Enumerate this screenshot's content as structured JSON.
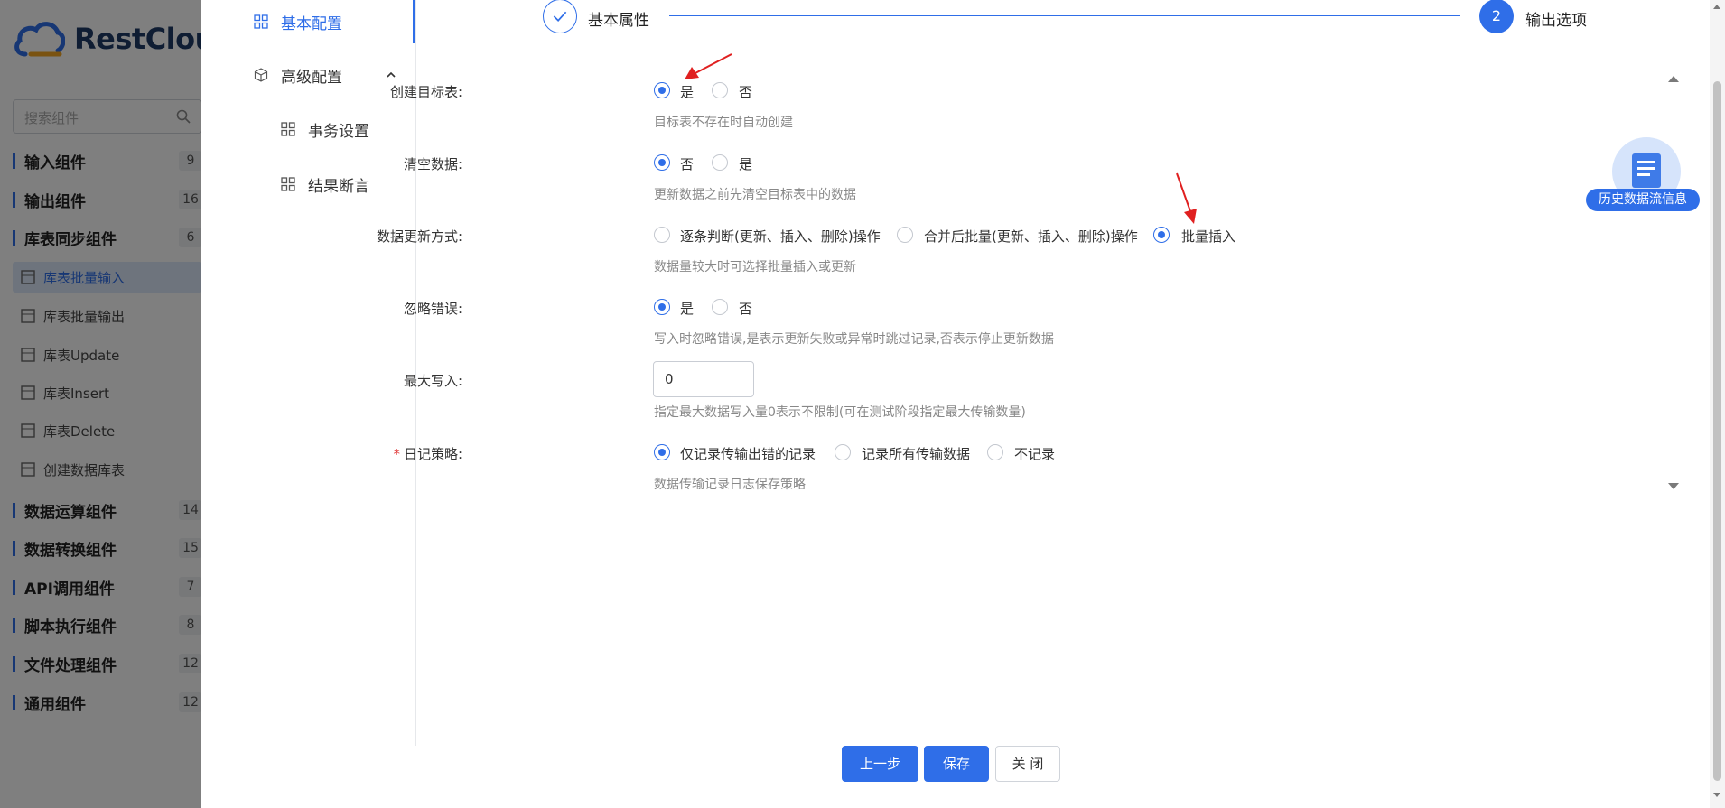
{
  "background": {
    "brand": "RestCloud",
    "search_placeholder": "搜索组件",
    "groups": [
      {
        "label": "输入组件",
        "count": "9"
      },
      {
        "label": "输出组件",
        "count": "16"
      },
      {
        "label": "库表同步组件",
        "count": "6"
      },
      {
        "label": "数据运算组件",
        "count": "14"
      },
      {
        "label": "数据转换组件",
        "count": "15"
      },
      {
        "label": "API调用组件",
        "count": "7"
      },
      {
        "label": "脚本执行组件",
        "count": "8"
      },
      {
        "label": "文件处理组件",
        "count": "12"
      },
      {
        "label": "通用组件",
        "count": "12"
      }
    ],
    "sync_items": [
      "库表批量输入",
      "库表批量输出",
      "库表Update",
      "库表Insert",
      "库表Delete",
      "创建数据库表"
    ]
  },
  "nav": {
    "basic": "基本配置",
    "advanced": "高级配置",
    "transaction": "事务设置",
    "assertion": "结果断言"
  },
  "steps": {
    "step1_label": "基本属性",
    "step2_number": "2",
    "step2_label": "输出选项"
  },
  "form": {
    "create_table": {
      "label": "创建目标表:",
      "opt_yes": "是",
      "opt_no": "否",
      "selected": "是",
      "hint": "目标表不存在时自动创建"
    },
    "clear_data": {
      "label": "清空数据:",
      "opt_no": "否",
      "opt_yes": "是",
      "selected": "否",
      "hint": "更新数据之前先清空目标表中的数据"
    },
    "update_mode": {
      "label": "数据更新方式:",
      "opt1": "逐条判断(更新、插入、删除)操作",
      "opt2": "合并后批量(更新、插入、删除)操作",
      "opt3": "批量插入",
      "selected": "批量插入",
      "hint": "数据量较大时可选择批量插入或更新"
    },
    "ignore_error": {
      "label": "忽略错误:",
      "opt_yes": "是",
      "opt_no": "否",
      "selected": "是",
      "hint": "写入时忽略错误,是表示更新失败或异常时跳过记录,否表示停止更新数据"
    },
    "max_write": {
      "label": "最大写入:",
      "value": "0",
      "hint": "指定最大数据写入量0表示不限制(可在测试阶段指定最大传输数量)"
    },
    "log_policy": {
      "required_mark": "*",
      "label": "日记策略:",
      "opt1": "仅记录传输出错的记录",
      "opt2": "记录所有传输数据",
      "opt3": "不记录",
      "selected": "仅记录传输出错的记录",
      "hint": "数据传输记录日志保存策略"
    }
  },
  "history_badge": "历史数据流信息",
  "buttons": {
    "prev": "上一步",
    "save": "保存",
    "close": "关 闭"
  },
  "colors": {
    "accent": "#2f6ee8",
    "annotation_arrow": "#e02020"
  }
}
